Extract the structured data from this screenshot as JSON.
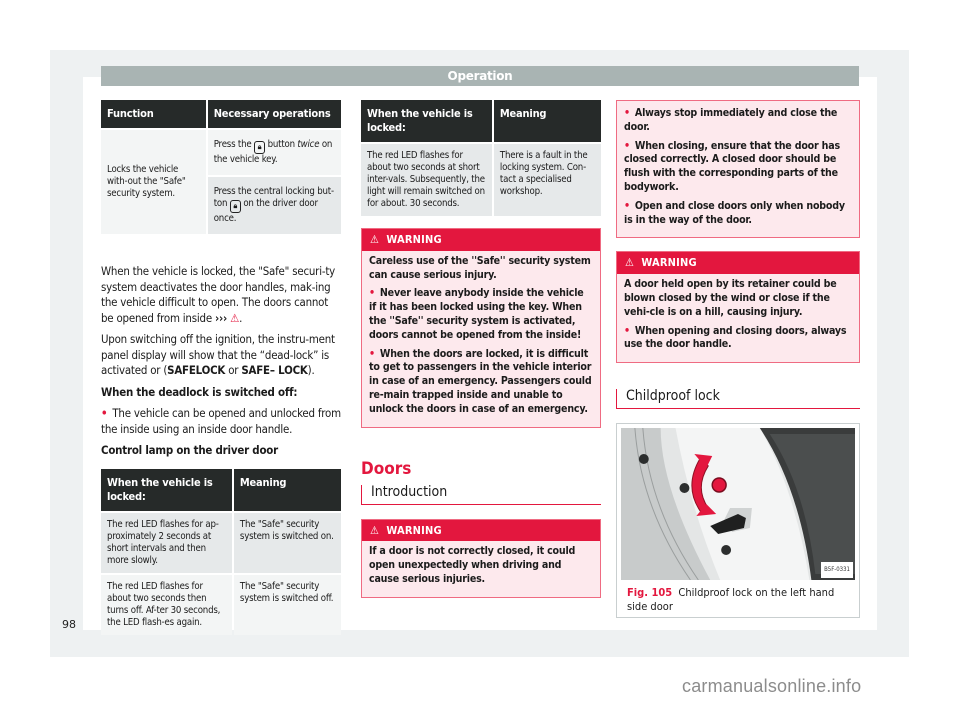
{
  "header": {
    "title": "Operation"
  },
  "page_number": "98",
  "watermark": "carmanualsonline.info",
  "colors": {
    "accent": "#e3173e",
    "header_bar": "#a9b4b3",
    "table_header": "#262a29",
    "warning_bg": "#fde9ed"
  },
  "table_function": {
    "headers": [
      "Function",
      "Necessary operations"
    ],
    "function": "Locks the vehicle with-out the \"Safe\" security system.",
    "ops": [
      {
        "pre": "Press the ",
        "icon": "lock-key-icon",
        "post_plain": " button ",
        "post_italic": "twice",
        "post_end": " on the vehicle key."
      },
      {
        "pre": "Press the central locking but-ton ",
        "icon": "lock-key-icon",
        "post_plain": " on the driver door once.",
        "post_italic": "",
        "post_end": ""
      }
    ]
  },
  "body": {
    "para1": "When the vehicle is locked, the \"Safe\" securi-ty system deactivates the door handles, mak-ing the vehicle difficult to open. The doors cannot be opened from inside",
    "para1_ref": "›››",
    "para2_pre": "Upon switching off the ignition, the instru-ment panel display will show that the “dead-lock” is activated or (",
    "para2_b1": "SAFELOCK",
    "para2_mid": " or ",
    "para2_b2": "SAFE– LOCK",
    "para2_end": ").",
    "deadlock_heading": "When the deadlock is switched off:",
    "deadlock_bullet": "The vehicle can be opened and unlocked from the inside using an inside door handle.",
    "control_lamp_heading": "Control lamp on the driver door"
  },
  "table_lamp": {
    "headers": [
      "When the vehicle is locked:",
      "Meaning"
    ],
    "rows": [
      [
        "The red LED flashes for ap-proximately 2 seconds at short intervals and then more slowly.",
        "The \"Safe\" security system is switched on."
      ],
      [
        "The red LED flashes for about two seconds then turns off. Af-ter 30 seconds, the LED flash-es again.",
        "The \"Safe\" security system is switched off."
      ],
      [
        "The red LED flashes for about two seconds at short inter-vals. Subsequently, the light will remain switched on for about. 30 seconds.",
        "There is a fault in the locking system. Con-tact a specialised workshop."
      ]
    ]
  },
  "warning1": {
    "label": "WARNING",
    "intro": "Careless use of the ''Safe'' security system can cause serious injury.",
    "bullets": [
      "Never leave anybody inside the vehicle if it has been locked using the key. When the ''Safe'' security system is activated, doors cannot be opened from the inside!",
      "When the doors are locked, it is difficult to get to passengers in the vehicle interior in case of an emergency. Passengers could re-main trapped inside and unable to unlock the doors in case of an emergency."
    ]
  },
  "doors": {
    "title": "Doors",
    "subtitle": "Introduction"
  },
  "warning2": {
    "label": "WARNING",
    "intro": "If a door is not correctly closed, it could open unexpectedly when driving and cause serious injuries.",
    "continued_bullets": [
      "Always stop immediately and close the door.",
      "When closing, ensure that the door has closed correctly. A closed door should be flush with the corresponding parts of the bodywork.",
      "Open and close doors only when nobody is in the way of the door."
    ]
  },
  "warning3": {
    "label": "WARNING",
    "intro": "A door held open by its retainer could be blown closed by the wind or close if the vehi-cle is on a hill, causing injury.",
    "bullets": [
      "When opening and closing doors, always use the door handle."
    ]
  },
  "childproof": {
    "title": "Childproof lock",
    "figure": {
      "code": "B5F-0331",
      "label": "Fig. 105",
      "caption": "Childproof lock on the left hand side door"
    }
  }
}
